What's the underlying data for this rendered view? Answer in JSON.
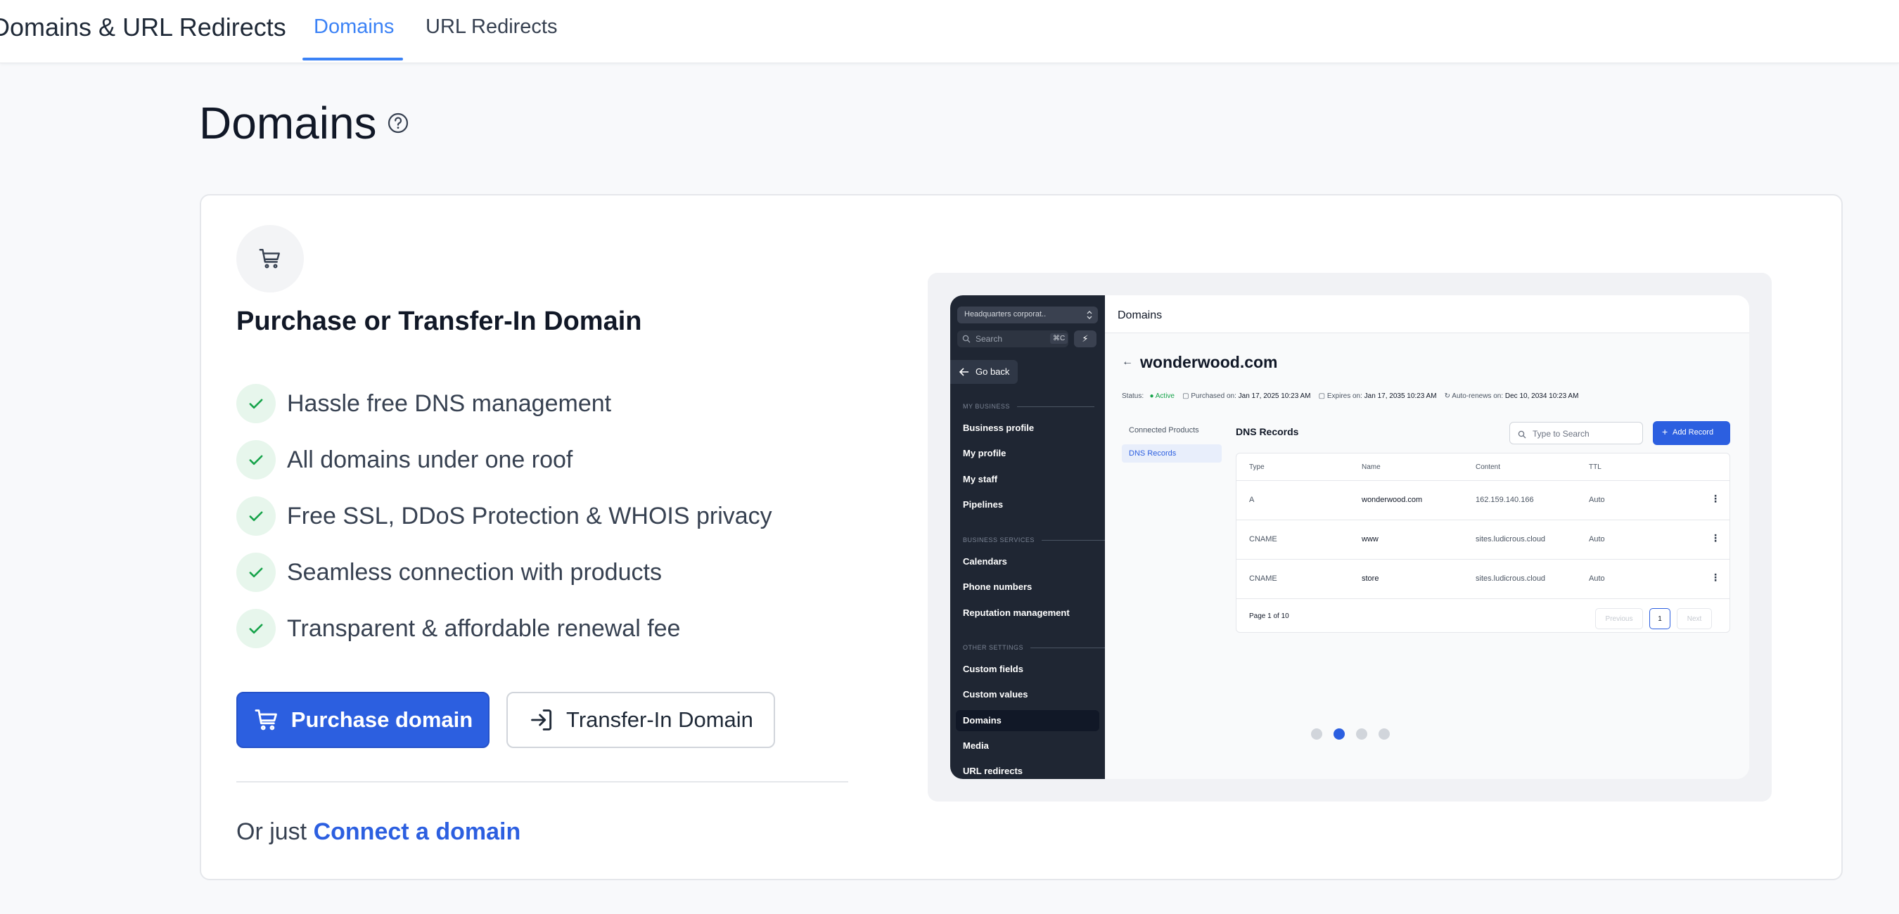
{
  "header": {
    "app_title": "Domains & URL Redirects",
    "tabs": [
      {
        "label": "Domains",
        "active": true
      },
      {
        "label": "URL Redirects",
        "active": false
      }
    ]
  },
  "page": {
    "title": "Domains"
  },
  "card": {
    "heading": "Purchase or Transfer-In Domain",
    "features": [
      "Hassle free DNS management",
      "All domains under one roof",
      "Free SSL, DDoS Protection & WHOIS privacy",
      "Seamless connection with products",
      "Transparent & affordable renewal fee"
    ],
    "purchase_button": "Purchase domain",
    "transfer_button": "Transfer-In Domain",
    "connect_prefix": "Or just",
    "connect_link": "Connect a domain"
  },
  "preview": {
    "sidebar": {
      "account": "Headquarters corporat..",
      "search_placeholder": "Search",
      "shortcut": "⌘C",
      "go_back": "Go back",
      "sections": [
        "MY BUSINESS",
        "BUSINESS SERVICES",
        "OTHER SETTINGS"
      ],
      "items": [
        "Business profile",
        "My profile",
        "My staff",
        "Pipelines",
        "Calendars",
        "Phone numbers",
        "Reputation management",
        "Custom fields",
        "Custom values",
        "Domains",
        "Media",
        "URL redirects"
      ]
    },
    "main": {
      "header": "Domains",
      "domain": "wonderwood.com",
      "status_label": "Status:",
      "status_value": "Active",
      "purchased_label": "Purchased on:",
      "purchased_value": "Jan 17, 2025 10:23 AM",
      "expires_label": "Expires on:",
      "expires_value": "Jan 17, 2035 10:23 AM",
      "renews_label": "Auto-renews on:",
      "renews_value": "Dec 10, 2034 10:23 AM",
      "subnav": [
        "Connected Products",
        "DNS Records"
      ],
      "dns_title": "DNS Records",
      "search_placeholder": "Type to Search",
      "add_button": "Add Record",
      "columns": [
        "Type",
        "Name",
        "Content",
        "TTL"
      ],
      "rows": [
        {
          "type": "A",
          "name": "wonderwood.com",
          "content": "162.159.140.166",
          "ttl": "Auto"
        },
        {
          "type": "CNAME",
          "name": "www",
          "content": "sites.ludicrous.cloud",
          "ttl": "Auto"
        },
        {
          "type": "CNAME",
          "name": "store",
          "content": "sites.ludicrous.cloud",
          "ttl": "Auto"
        }
      ],
      "page_info": "Page 1 of 10",
      "prev": "Previous",
      "page_num": "1",
      "next": "Next"
    },
    "carousel": {
      "count": 4,
      "active_index": 1
    }
  },
  "colors": {
    "accent": "#2c5fe0",
    "tab_active": "#3b82f6",
    "check": "#16a34a",
    "check_bg": "#e7f6ec",
    "sidebar_bg": "#1f2633"
  }
}
